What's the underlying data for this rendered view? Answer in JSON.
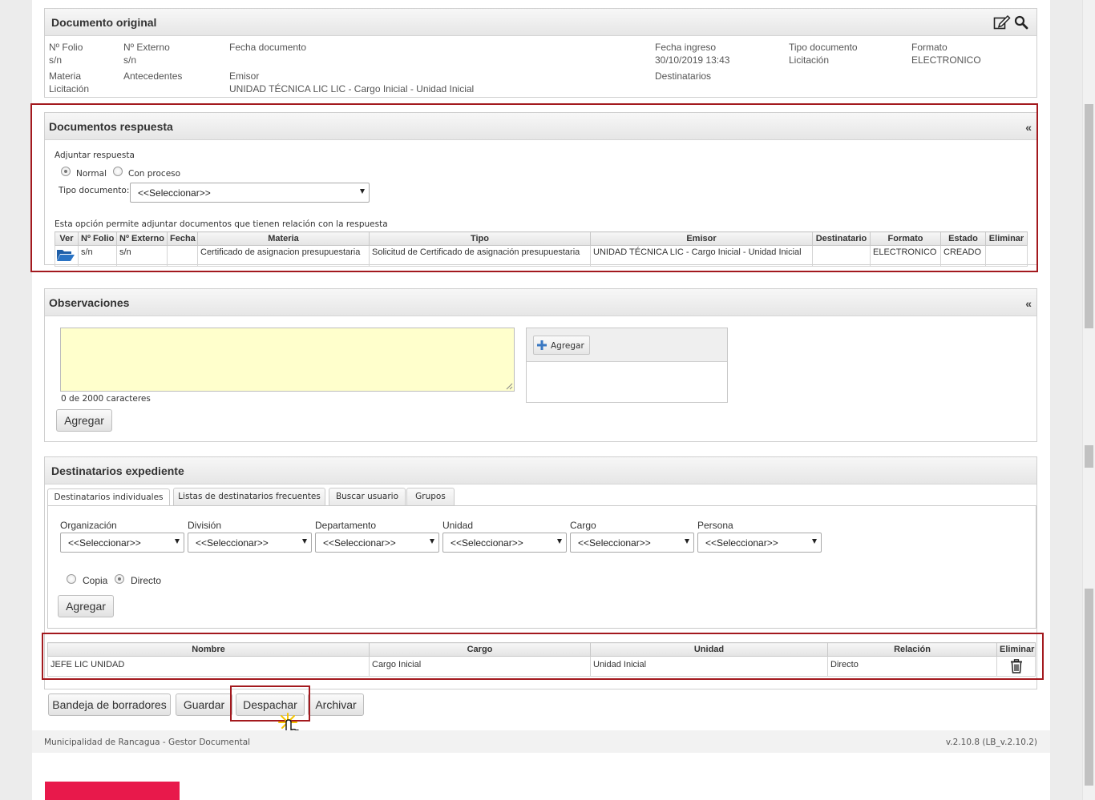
{
  "documento_original": {
    "title": "Documento original",
    "fields": {
      "folio_label": "Nº Folio",
      "folio_value": "s/n",
      "externo_label": "Nº Externo",
      "externo_value": "s/n",
      "fecha_doc_label": "Fecha documento",
      "fecha_ingreso_label": "Fecha ingreso",
      "fecha_ingreso_value": "30/10/2019 13:43",
      "tipo_doc_label": "Tipo documento",
      "tipo_doc_value": "Licitación",
      "formato_label": "Formato",
      "formato_value": "ELECTRONICO",
      "materia_label": "Materia",
      "materia_value": "Licitación",
      "antecedentes_label": "Antecedentes",
      "emisor_label": "Emisor",
      "emisor_value": "UNIDAD TÉCNICA LIC LIC - Cargo Inicial - Unidad Inicial",
      "destinatarios_label": "Destinatarios"
    }
  },
  "documentos_respuesta": {
    "title": "Documentos respuesta",
    "collapse": "«",
    "adjuntar_label": "Adjuntar respuesta",
    "radio_normal": "Normal",
    "radio_con_proceso": "Con proceso",
    "tipo_documento_label": "Tipo documento:",
    "tipo_documento_value": "<<Seleccionar>>",
    "info_text": "Esta opción permite adjuntar documentos que tienen relación con la respuesta",
    "columns": [
      "Ver",
      "Nº Folio",
      "Nº Externo",
      "Fecha",
      "Materia",
      "Tipo",
      "Emisor",
      "Destinatario",
      "Formato",
      "Estado",
      "Eliminar"
    ],
    "rows": [
      {
        "folio": "s/n",
        "externo": "s/n",
        "fecha": "",
        "materia": "Certificado de asignacion presupuestaria",
        "tipo": "Solicitud de Certificado de asignación presupuestaria",
        "emisor": "UNIDAD TÉCNICA LIC - Cargo Inicial - Unidad Inicial",
        "destinatario": "",
        "formato": "ELECTRONICO",
        "estado": "CREADO"
      }
    ]
  },
  "observaciones": {
    "title": "Observaciones",
    "collapse": "«",
    "char_count": "0 de 2000 caracteres",
    "agregar_small": "Agregar",
    "agregar_button": "Agregar"
  },
  "destinatarios_expediente": {
    "title": "Destinatarios expediente",
    "tabs": [
      "Destinatarios individuales",
      "Listas de destinatarios frecuentes",
      "Buscar usuario",
      "Grupos"
    ],
    "filters": [
      {
        "label": "Organización",
        "value": "<<Seleccionar>>"
      },
      {
        "label": "División",
        "value": "<<Seleccionar>>"
      },
      {
        "label": "Departamento",
        "value": "<<Seleccionar>>"
      },
      {
        "label": "Unidad",
        "value": "<<Seleccionar>>"
      },
      {
        "label": "Cargo",
        "value": "<<Seleccionar>>"
      },
      {
        "label": "Persona",
        "value": "<<Seleccionar>>"
      }
    ],
    "radio_copia": "Copia",
    "radio_directo": "Directo",
    "agregar_button": "Agregar",
    "columns": [
      "Nombre",
      "Cargo",
      "Unidad",
      "Relación",
      "Eliminar"
    ],
    "rows": [
      {
        "nombre": "JEFE LIC UNIDAD",
        "cargo": "Cargo Inicial",
        "unidad": "Unidad Inicial",
        "relacion": "Directo"
      }
    ]
  },
  "actions": {
    "bandeja": "Bandeja de borradores",
    "guardar": "Guardar",
    "despachar": "Despachar",
    "archivar": "Archivar"
  },
  "footer": {
    "left": "Municipalidad de Rancagua - Gestor Documental",
    "right": "v.2.10.8 (LB_v.2.10.2)"
  },
  "colors": {
    "highlight": "#a3191e",
    "brand_bar": "#e8194b",
    "textarea_bg": "#ffffcc",
    "icon_blue": "#1f5fa8"
  },
  "icons": [
    "edit-icon",
    "search-icon",
    "folder-open-icon",
    "plus-icon",
    "trash-icon",
    "hand-pointer-icon"
  ]
}
